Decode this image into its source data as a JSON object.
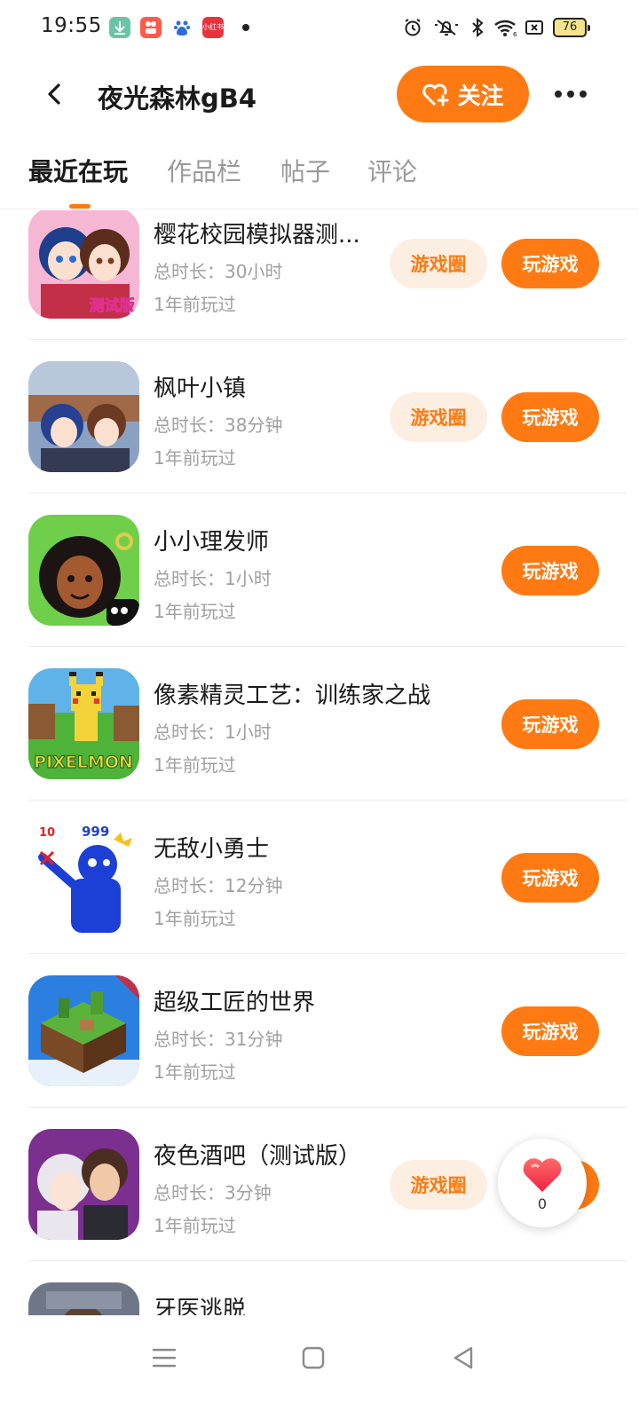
{
  "status_bar": {
    "time": "19:55",
    "apps": [
      {
        "icon": "download-app-icon",
        "color": "#6cc4a6"
      },
      {
        "icon": "kuaishou-app-icon",
        "color": "#ff5a4a"
      },
      {
        "icon": "baidu-app-icon",
        "color": "#2e6bdc"
      },
      {
        "icon": "xiaohongshu-app-icon",
        "color": "#e8323c",
        "label": "小红书"
      }
    ],
    "battery": "76"
  },
  "header": {
    "title": "夜光森林gB4",
    "follow_label": "关注"
  },
  "tabs": [
    {
      "label": "最近在玩",
      "active": true
    },
    {
      "label": "作品栏",
      "active": false
    },
    {
      "label": "帖子",
      "active": false
    },
    {
      "label": "评论",
      "active": false
    }
  ],
  "games": [
    {
      "name": "樱花校园模拟器测...",
      "time": "总时长：30小时",
      "last_played": "1年前玩过",
      "circle_label": "游戏圈",
      "play_label": "玩游戏"
    },
    {
      "name": "枫叶小镇",
      "time": "总时长：38分钟",
      "last_played": "1年前玩过",
      "circle_label": "游戏圈",
      "play_label": "玩游戏"
    },
    {
      "name": "小小理发师",
      "time": "总时长：1小时",
      "last_played": "1年前玩过",
      "play_label": "玩游戏"
    },
    {
      "name": "像素精灵工艺：训练家之战",
      "time": "总时长：1小时",
      "last_played": "1年前玩过",
      "play_label": "玩游戏"
    },
    {
      "name": "无敌小勇士",
      "time": "总时长：12分钟",
      "last_played": "1年前玩过",
      "play_label": "玩游戏",
      "icon_text_a": "10",
      "icon_text_b": "999"
    },
    {
      "name": "超级工匠的世界",
      "time": "总时长：31分钟",
      "last_played": "1年前玩过",
      "play_label": "玩游戏"
    },
    {
      "name": "夜色酒吧（测试版）",
      "time": "总时长：3分钟",
      "last_played": "1年前玩过",
      "circle_label": "游戏圈",
      "play_label": "玩游戏"
    },
    {
      "name": "牙医逃脱"
    }
  ],
  "icon_labels": {
    "sakura_badge": "测试版",
    "pixelmon_logo": "PIXELMON"
  },
  "like": {
    "count": "0"
  },
  "colors": {
    "accent": "#ff7a12",
    "circle_bg": "#fdeee2"
  }
}
